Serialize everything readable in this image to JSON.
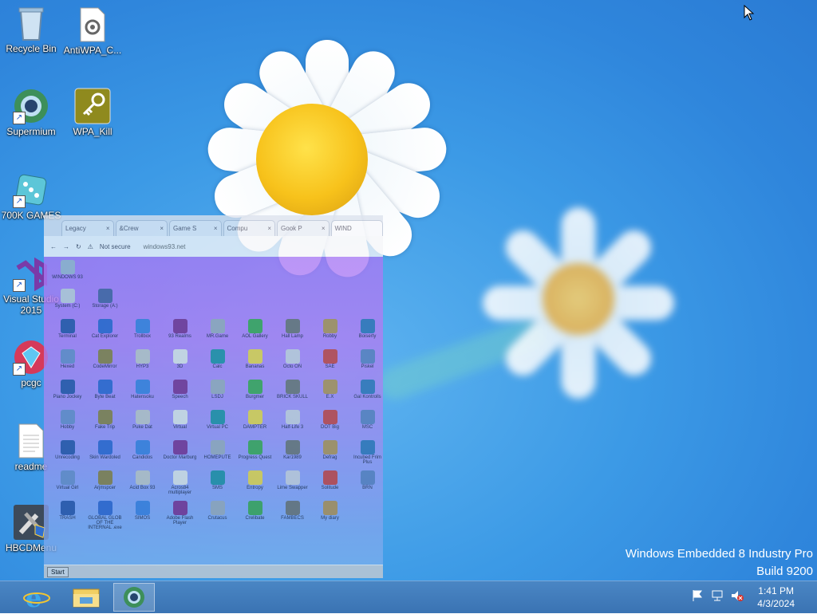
{
  "desktop_icons": [
    {
      "label": "Recycle Bin",
      "icon": "recycle-bin-icon"
    },
    {
      "label": "AntiWPA_C...",
      "icon": "settings-file-icon"
    },
    {
      "label": "Supermium",
      "icon": "supermium-icon"
    },
    {
      "label": "WPA_Kill",
      "icon": "key-icon"
    },
    {
      "label": "700K GAMES",
      "icon": "dice-icon"
    },
    {
      "label": "Visual Studio 2015",
      "icon": "visual-studio-icon"
    },
    {
      "label": "pcgc",
      "icon": "gem-icon"
    },
    {
      "label": "readme",
      "icon": "text-file-icon"
    },
    {
      "label": "HBCDMenu",
      "icon": "tools-icon"
    }
  ],
  "browser": {
    "tabs": [
      "Legacy",
      "&Crew",
      "Game S",
      "Compu",
      "Gook P",
      "WIND"
    ],
    "security_label": "Not secure",
    "url": "windows93.net",
    "page_icons": [
      "WINDOWS 93",
      "System (C:)",
      "Storage (A:)",
      "Terminal",
      "Cat Explorer",
      "Trollbox",
      "93 Realms",
      "MR.Game",
      "AOL Gallery",
      "Hall Lamp",
      "Robby",
      "Boiserty",
      "Hexed",
      "CodeMirror",
      "HYP3",
      "3D",
      "Calc",
      "Bananas",
      "Octo ON",
      "SAE",
      "Piskel",
      "Piano Jockey",
      "Byte Beat",
      "Hatensoku",
      "Speech",
      "LSDJ",
      "Burgmer",
      "BRICK SKULL",
      "E.X",
      "Gal Kontrolls",
      "Hobby",
      "Fake Trip",
      "Puke Dat",
      "Virtual",
      "Virtual PC",
      "DAMPTER",
      "Half-Life 3",
      "DOT Big",
      "MSC",
      "Unrecoding",
      "Skin Wardoled",
      "Candidos",
      "Doctor Marburg",
      "HOMEPUTE",
      "Progress Quest",
      "Kar1989",
      "Defrag",
      "Incubed Frim Plus",
      "Virtual Girl",
      "Arjmspcer",
      "Acid Box 93",
      "Acros84 multiplayer",
      "SMS",
      "Entropy",
      "Lime Swapper",
      "Solitude",
      "BRN",
      "TRASH",
      "GLOBAL GLOB OF THE INTERNAL .exe",
      "SIMOS",
      "Adobe Flash Player",
      "Crutacus",
      "Crelibate",
      "FAMBECS",
      "My diary"
    ],
    "start_label": "Start"
  },
  "watermark": {
    "line1": "Windows Embedded 8 Industry Pro",
    "line2": "Build 9200"
  },
  "taskbar": {
    "pinned": [
      "internet-explorer-icon",
      "file-explorer-icon",
      "supermium-icon"
    ],
    "tray": [
      "flag-icon",
      "network-icon",
      "volume-muted-icon"
    ],
    "time": "1:41 PM",
    "date": "4/3/2024"
  }
}
